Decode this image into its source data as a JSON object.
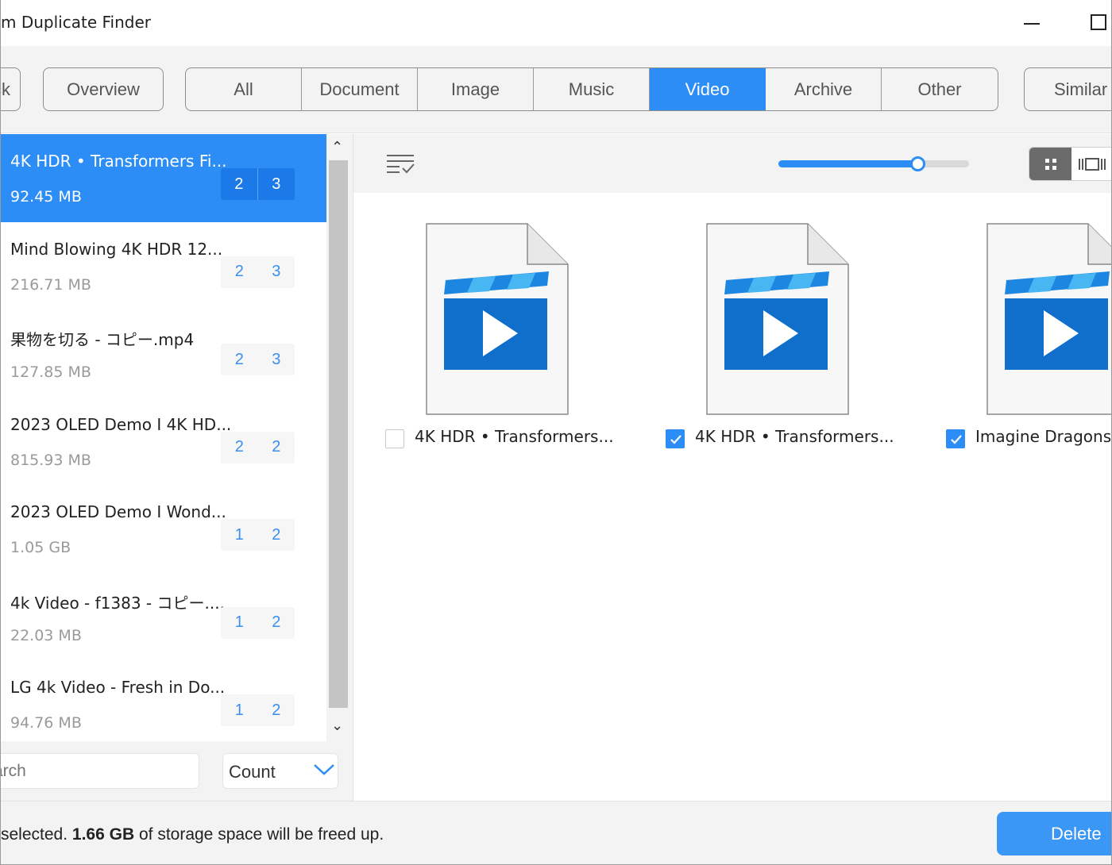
{
  "window": {
    "title": "m Duplicate Finder",
    "controls": [
      "minimize",
      "maximize"
    ]
  },
  "toolbar": {
    "back_label": "ck",
    "overview_label": "Overview",
    "tabs": [
      {
        "label": "All",
        "active": false
      },
      {
        "label": "Document",
        "active": false
      },
      {
        "label": "Image",
        "active": false
      },
      {
        "label": "Music",
        "active": false
      },
      {
        "label": "Video",
        "active": true
      },
      {
        "label": "Archive",
        "active": false
      },
      {
        "label": "Other",
        "active": false
      }
    ],
    "similar_label": "Similar"
  },
  "groups": [
    {
      "name": "4K HDR • Transformers Fi...",
      "size": "92.45 MB",
      "count_a": "2",
      "count_b": "3",
      "selected": true
    },
    {
      "name": "Mind Blowing 4K HDR 12...",
      "size": "216.71 MB",
      "count_a": "2",
      "count_b": "3",
      "selected": false
    },
    {
      "name": "果物を切る - コピー.mp4",
      "size": "127.85 MB",
      "count_a": "2",
      "count_b": "3",
      "selected": false
    },
    {
      "name": "2023 OLED Demo I 4K HD...",
      "size": "815.93 MB",
      "count_a": "2",
      "count_b": "2",
      "selected": false
    },
    {
      "name": "2023 OLED Demo I Wond...",
      "size": "1.05 GB",
      "count_a": "1",
      "count_b": "2",
      "selected": false
    },
    {
      "name": "4k Video - f1383 - コピー....",
      "size": "22.03 MB",
      "count_a": "1",
      "count_b": "2",
      "selected": false
    },
    {
      "name": "LG 4k Video - Fresh in Do...",
      "size": "94.76 MB",
      "count_a": "1",
      "count_b": "2",
      "selected": false
    }
  ],
  "search": {
    "placeholder": "arch"
  },
  "sort": {
    "selected": "Count"
  },
  "preview": {
    "thumbnail_size_fraction": 0.73,
    "view_mode": "grid"
  },
  "files": [
    {
      "name": "4K HDR • Transformers...",
      "checked": false
    },
    {
      "name": "4K HDR • Transformers...",
      "checked": true
    },
    {
      "name": "Imagine Dragons",
      "checked": true
    }
  ],
  "status": {
    "prefix": "selected.",
    "amount": "1.66 GB",
    "suffix": "of storage space will be freed up.",
    "delete_label": "Delete"
  },
  "colors": {
    "accent": "#2b8df5",
    "panel_bg": "#f3f3f3",
    "count_text": "#3a8ff0"
  },
  "icons": [
    "minimize-icon",
    "maximize-icon",
    "scroll-up-icon",
    "scroll-down-icon",
    "chevron-down-icon",
    "select-list-icon",
    "grid-view-icon",
    "filmstrip-view-icon",
    "video-file-icon",
    "checkbox-icon"
  ]
}
